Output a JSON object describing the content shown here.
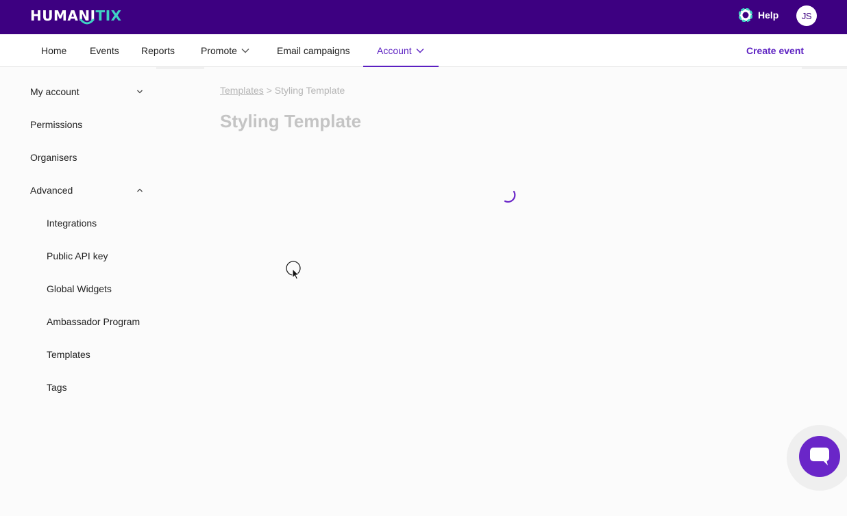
{
  "brand": {
    "name_part1": "HUMANI",
    "name_part2": "TIX"
  },
  "header": {
    "help_label": "Help",
    "user_initials": "JS"
  },
  "nav": {
    "items": [
      {
        "label": "Home"
      },
      {
        "label": "Events"
      },
      {
        "label": "Reports"
      },
      {
        "label": "Promote"
      },
      {
        "label": "Email campaigns"
      },
      {
        "label": "Account"
      }
    ],
    "create_event_label": "Create event"
  },
  "sidebar": {
    "items": [
      {
        "label": "My account"
      },
      {
        "label": "Permissions"
      },
      {
        "label": "Organisers"
      },
      {
        "label": "Advanced"
      }
    ],
    "advanced_items": [
      {
        "label": "Integrations"
      },
      {
        "label": "Public API key"
      },
      {
        "label": "Global Widgets"
      },
      {
        "label": "Ambassador Program"
      },
      {
        "label": "Templates"
      },
      {
        "label": "Tags"
      }
    ]
  },
  "breadcrumb": {
    "parent": "Templates",
    "separator": ">",
    "current": "Styling Template"
  },
  "page": {
    "title": "Styling Template"
  },
  "icons": {
    "help": "lifebuoy-icon",
    "promote_chevron": "chevron-down-icon",
    "account_chevron": "chevron-down-icon",
    "my_account_chevron": "chevron-down-icon",
    "advanced_chevron": "chevron-up-icon",
    "spinner": "loading-spinner-icon",
    "chat": "chat-bubble-icon"
  },
  "colors": {
    "header_bg": "#3d0081",
    "accent": "#5b1fc1",
    "logo_accent": "#3fd3c4",
    "chat_button": "#6a26c8"
  }
}
